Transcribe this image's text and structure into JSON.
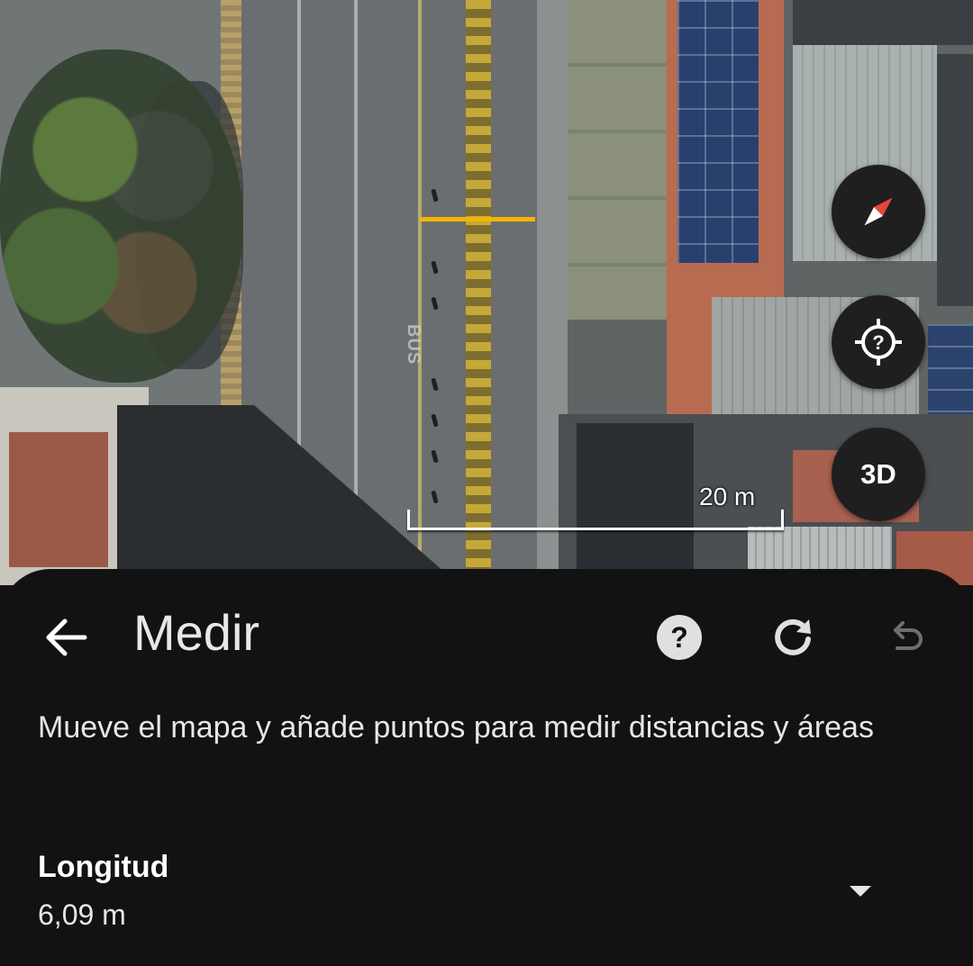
{
  "map": {
    "road_marking": "BUS",
    "scale_label": "20 m",
    "measure_line_color": "#f4b400"
  },
  "controls": {
    "compass_icon": "compass-icon",
    "locate_icon": "location-help-icon",
    "three_d_label": "3D"
  },
  "panel": {
    "back_icon": "arrow-left-icon",
    "title": "Medir",
    "help_icon": "help-circle-icon",
    "redo_icon": "redo-icon",
    "undo_icon": "undo-icon",
    "instructions": "Mueve el mapa y añade puntos para medir distancias y áreas",
    "length_label": "Longitud",
    "length_value": "6,09 m",
    "dropdown_icon": "caret-down-icon"
  },
  "colors": {
    "panel_background": "#121212",
    "accent_line": "#f4b400",
    "button_background": "#1f1f1f"
  }
}
